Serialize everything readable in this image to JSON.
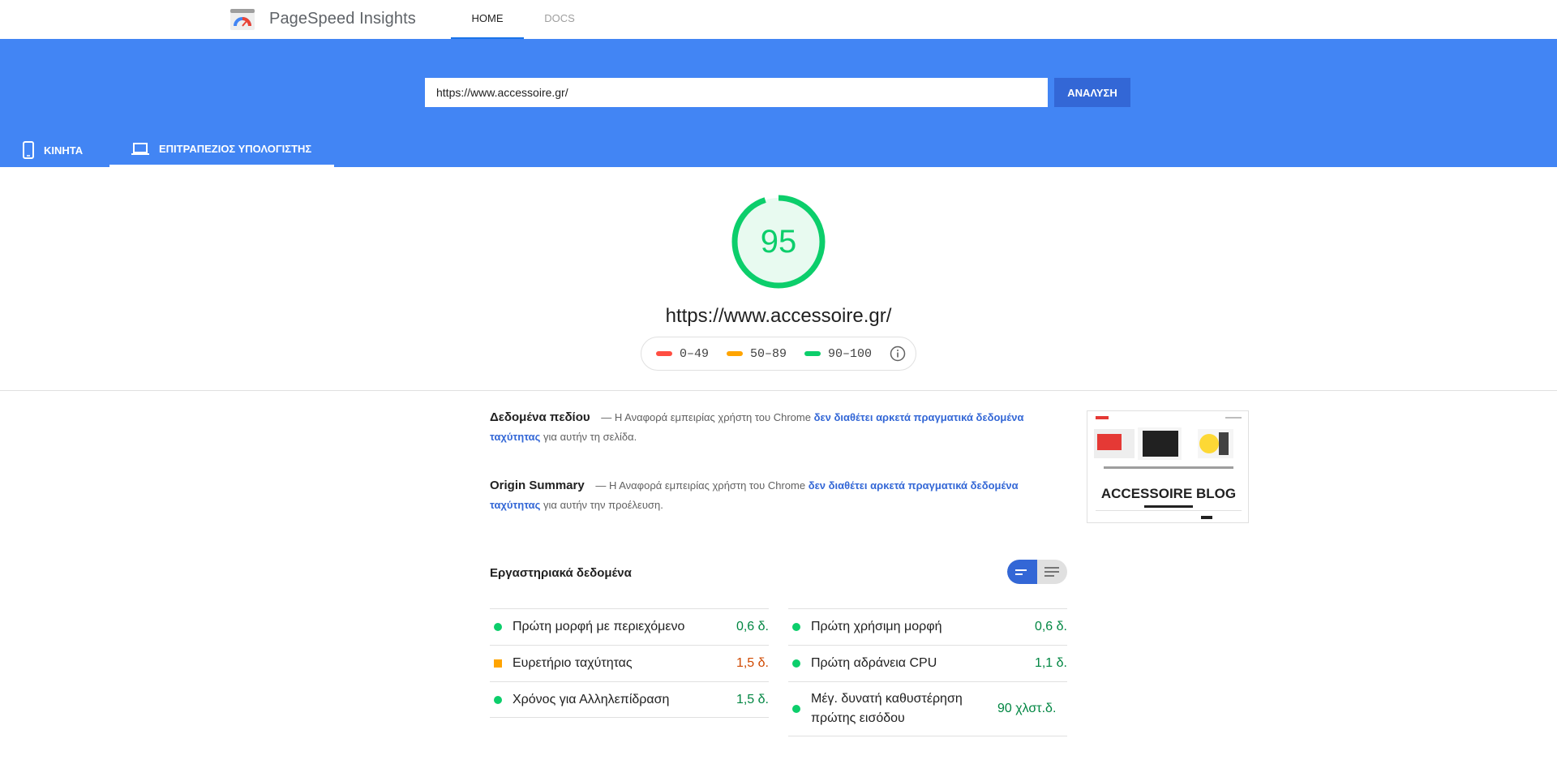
{
  "app": {
    "title": "PageSpeed Insights"
  },
  "nav": {
    "home": "HOME",
    "docs": "DOCS"
  },
  "search": {
    "url_value": "https://www.accessoire.gr/",
    "analyze_label": "ΑΝΑΛΥΣΗ"
  },
  "device_tabs": {
    "mobile": "ΚΙΝΗΤΑ",
    "desktop": "ΕΠΙΤΡΑΠΕΖΙΟΣ ΥΠΟΛΟΓΙΣΤΗΣ",
    "active": "desktop"
  },
  "score": {
    "value": "95",
    "fraction": 0.95,
    "url": "https://www.accessoire.gr/"
  },
  "legend": [
    {
      "range": "0–49",
      "color": "#ff4e42"
    },
    {
      "range": "50–89",
      "color": "#ffa400"
    },
    {
      "range": "90–100",
      "color": "#0cce6b"
    }
  ],
  "field_data": {
    "title": "Δεδομένα πεδίου",
    "text_before": "— Η Αναφορά εμπειρίας χρήστη του Chrome",
    "link": "δεν διαθέτει αρκετά πραγματικά δεδομένα ταχύτητας",
    "text_after": "για αυτήν τη σελίδα."
  },
  "origin_summary": {
    "title": "Origin Summary",
    "text_before": "— Η Αναφορά εμπειρίας χρήστη του Chrome",
    "link": "δεν διαθέτει αρκετά πραγματικά δεδομένα ταχύτητας",
    "text_after": "για αυτήν την προέλευση."
  },
  "thumbnail": {
    "banner_text": "ACCESSOIRE BLOG"
  },
  "lab_data": {
    "title": "Εργαστηριακά δεδομένα",
    "left": [
      {
        "label": "Πρώτη μορφή με περιεχόμενο",
        "value": "0,6 δ.",
        "status": "good"
      },
      {
        "label": "Ευρετήριο ταχύτητας",
        "value": "1,5 δ.",
        "status": "average"
      },
      {
        "label": "Χρόνος για Αλληλεπίδραση",
        "value": "1,5 δ.",
        "status": "good"
      }
    ],
    "right": [
      {
        "label": "Πρώτη χρήσιμη μορφή",
        "value": "0,6 δ.",
        "status": "good"
      },
      {
        "label": "Πρώτη αδράνεια CPU",
        "value": "1,1 δ.",
        "status": "good"
      },
      {
        "label": "Μέγ. δυνατή καθυστέρηση πρώτης εισόδου",
        "value": "90 χλστ.δ.",
        "status": "good"
      }
    ]
  },
  "colors": {
    "brand_blue": "#4285f4",
    "button_blue": "#3367d6",
    "good": "#0cce6b",
    "good_text": "#018642",
    "average": "#ffa400",
    "average_text": "#d04900"
  }
}
